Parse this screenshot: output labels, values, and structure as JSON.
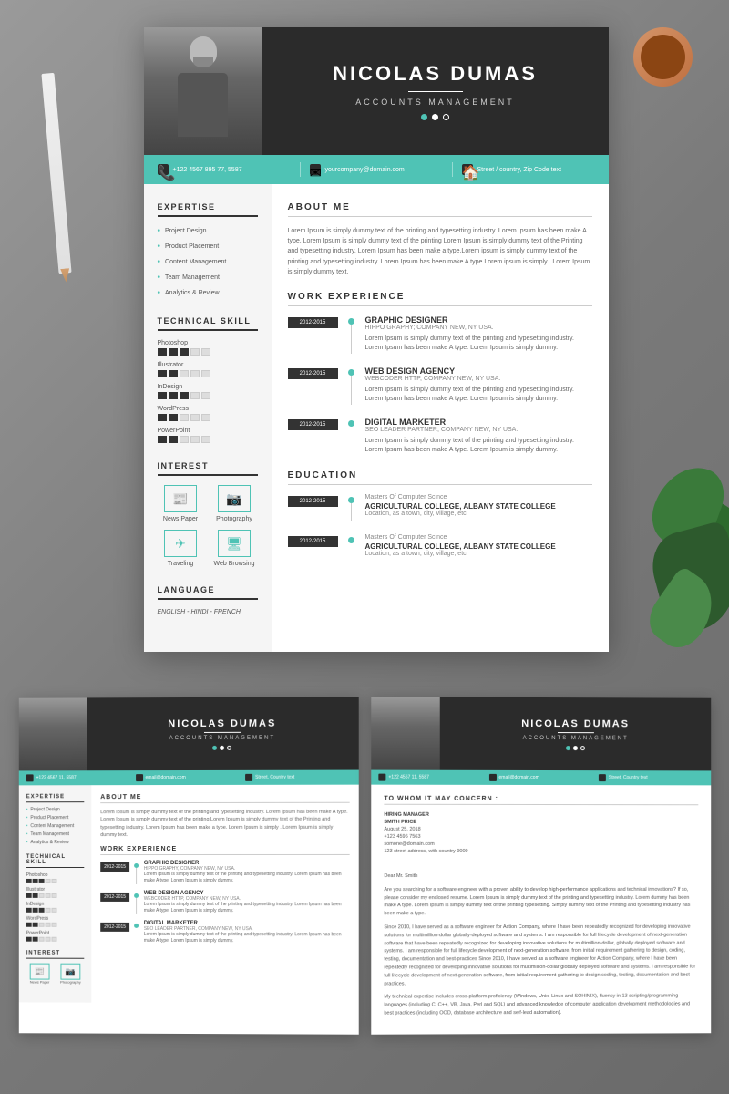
{
  "background": {
    "color": "#8a8a8a"
  },
  "main_resume": {
    "header": {
      "name": "NICOLAS DUMAS",
      "title": "ACCOUNTS MANAGEMENT",
      "dots": [
        "active",
        "default",
        "outline"
      ]
    },
    "contact": {
      "phone": "+122 4567 895 77, 5587",
      "email": "yourcompany@domain.com",
      "address": "Street / country, Zip Code text"
    },
    "sidebar": {
      "expertise_title": "EXPERTISE",
      "expertise_items": [
        "Project Design",
        "Product Placement",
        "Content Management",
        "Team Management",
        "Analytics & Review"
      ],
      "technical_title": "TECHNICAL SKILL",
      "skills": [
        {
          "name": "Photoshop",
          "filled": 3,
          "empty": 2
        },
        {
          "name": "Illustrator",
          "filled": 2,
          "empty": 3
        },
        {
          "name": "InDesign",
          "filled": 3,
          "empty": 2
        },
        {
          "name": "WordPress",
          "filled": 2,
          "empty": 3
        },
        {
          "name": "PowerPoint",
          "filled": 2,
          "empty": 3
        }
      ],
      "interest_title": "INTEREST",
      "interests": [
        {
          "icon": "📰",
          "label": "News Paper"
        },
        {
          "icon": "📷",
          "label": "Photography"
        },
        {
          "icon": "✈",
          "label": "Traveling"
        },
        {
          "icon": "🌐",
          "label": "Web Browsing"
        }
      ],
      "language_title": "LANGUAGE",
      "languages": "ENGLISH - HINDI - FRENCH"
    },
    "about": {
      "title": "ABOUT ME",
      "text": "Lorem Ipsum is simply dummy text of the printing and typesetting industry. Lorem Ipsum has been make A type. Lorem Ipsum is simply dummy text of the printing Lorem Ipsum is simply dummy text of the Printing and typesetting industry. Lorem Ipsum has been make a type.Lorem ipsum is simply dummy text of the printing and typesetting industry. Lorem Ipsum has been make A type.Lorem ipsum is simply . Lorem Ipsum is simply dummy text."
    },
    "work_experience": {
      "title": "WORK EXPERIENCE",
      "jobs": [
        {
          "years": "2012-2015",
          "title": "GRAPHIC DESIGNER",
          "company": "HIPPO GRAPHY; COMPANY NEW, NY USA.",
          "desc": "Lorem Ipsum is simply dummy text of the printing and typesetting industry. Lorem Ipsum has been make A type. Lorem Ipsum is simply dummy."
        },
        {
          "years": "2012-2015",
          "title": "WEB DESIGN AGENCY",
          "company": "WEBCODER HTTP, COMPANY NEW, NY USA.",
          "desc": "Lorem Ipsum is simply dummy text of the printing and typesetting industry. Lorem Ipsum has been make A type. Lorem Ipsum is simply dummy."
        },
        {
          "years": "2012-2015",
          "title": "DIGITAL MARKETER",
          "company": "SEO LEADER PARTNER, COMPANY NEW, NY USA.",
          "desc": "Lorem Ipsum is simply dummy text of the printing and typesetting industry. Lorem Ipsum has been make A type. Lorem Ipsum is simply dummy."
        }
      ]
    },
    "education": {
      "title": "EDUCATION",
      "items": [
        {
          "years": "2012-2015",
          "subtitle": "Masters Of Computer Scince",
          "title": "AGRICULTURAL COLLEGE, ALBANY STATE COLLEGE",
          "location": "Location, as a town, city, village, etc"
        },
        {
          "years": "2012-2015",
          "subtitle": "Masters Of Computer Scince",
          "title": "AGRICULTURAL COLLEGE, ALBANY STATE COLLEGE",
          "location": "Location, as a town, city, village, etc"
        }
      ]
    }
  },
  "bottom_left": {
    "header": {
      "name": "NICOLAS DUMAS",
      "title": "ACCOUNTS MANAGEMENT"
    }
  },
  "bottom_right": {
    "header": {
      "name": "NICOLAS DUMAS",
      "title": "ACCOUNTS MANAGEMENT"
    },
    "cover": {
      "section_title": "TO WHOM IT MAY CONCERN :",
      "hiring_manager": "HIRING MANAGER",
      "name": "SMITH PRICE",
      "date": "August 25, 2018",
      "phone": "+123 4596 7563",
      "email": "somone@domain.com",
      "address": "123 street address, with country 9009",
      "salutation": "Dear Mr. Smith",
      "body1": "Are you searching for a software engineer with a proven ability to develop high-performance applications and technical innovations? If so, please consider my enclosed resume. Lorem Ipsum is simply dummy text of the printing and typesetting industry. Lorem dummy has been make A type. Lorem Ipsum is simply dummy text of the printing typesetting. Simply dummy text of the Printing and typesetting Industry has been make a type.",
      "body2": "Since 2010, I have served as a software engineer for Action Company, where I have been repeatedly recognized for developing innovative solutions for multimillion-dollar globally-deployed software and systems. I am responsible for full lifecycle development of next-generation software that have been repeatedly recognized for developing innovative solutions for multimillion-dollar, globally deployed software and systems. I am responsible for full lifecycle development of next-generation software, from initial requirement gathering to design, coding, testing, documentation and best-practices Since 2010, I have served as a software engineer for Action Company, where I have been repeatedly recognized for developing innovative solutions for multimillion-dollar globally deployed software and systems. I am responsible for full lifecycle development of next-generation software, from initial requirement gathering to design coding, testing, documentation and best-practices.",
      "body3": "My technical expertise includes cross-platform proficiency (Windows, Unix, Linux and SOHINIX), fluency in 13 scripting/programming languages (including C, C++, VB, Java, Perl and SQL) and advanced knowledge of computer application development methodologies and best practices (including OOD, database architecture and self-lead automation)."
    }
  }
}
